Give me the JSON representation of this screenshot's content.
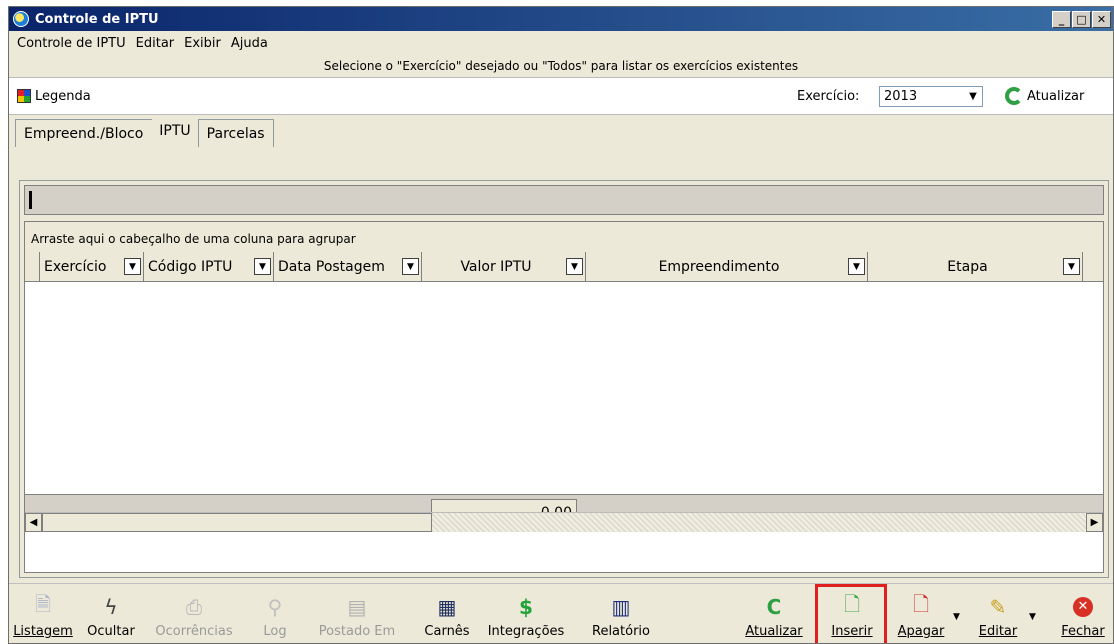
{
  "window": {
    "title": "Controle de IPTU"
  },
  "menu": [
    "Controle de IPTU",
    "Editar",
    "Exibir",
    "Ajuda"
  ],
  "hint": "Selecione o \"Exercício\" desejado ou \"Todos\" para listar os exercícios existentes",
  "filter": {
    "legend_label": "Legenda",
    "exercicio_label": "Exercício:",
    "exercicio_value": "2013",
    "refresh_label": "Atualizar"
  },
  "tabs": [
    {
      "label": "Empreend./Bloco",
      "active": false
    },
    {
      "label": "IPTU",
      "active": true
    },
    {
      "label": "Parcelas",
      "active": false
    }
  ],
  "grid": {
    "group_hint": "Arraste aqui o cabeçalho de uma coluna para agrupar",
    "columns": [
      "Exercício",
      "Código IPTU",
      "Data Postagem",
      "Valor IPTU",
      "Empreendimento",
      "Etapa"
    ],
    "total": "0,00"
  },
  "toolbar": [
    {
      "label": "Listagem",
      "icon": "document-icon",
      "enabled": true
    },
    {
      "label": "Ocultar",
      "icon": "lightning-icon",
      "enabled": true
    },
    {
      "label": "Ocorrências",
      "icon": "printer-icon",
      "enabled": false
    },
    {
      "label": "Log",
      "icon": "magnifier-icon",
      "enabled": false
    },
    {
      "label": "Postado Em",
      "icon": "calendar-icon",
      "enabled": false
    },
    {
      "label": "Carnês",
      "icon": "booklet-icon",
      "enabled": true
    },
    {
      "label": "Integrações",
      "icon": "dollar-icon",
      "enabled": true
    },
    {
      "label": "Relatório",
      "icon": "chart-edit-icon",
      "enabled": true
    },
    {
      "label": "Atualizar",
      "icon": "refresh-icon",
      "enabled": true
    },
    {
      "label": "Inserir",
      "icon": "new-document-icon",
      "enabled": true
    },
    {
      "label": "Apagar",
      "icon": "delete-document-icon",
      "enabled": true
    },
    {
      "label": "Editar",
      "icon": "edit-document-icon",
      "enabled": true
    },
    {
      "label": "Fechar",
      "icon": "close-circle-icon",
      "enabled": true
    }
  ],
  "colors": {
    "highlight": "#e02020",
    "titlebar": "#0a246a",
    "refresh": "#2ea043"
  }
}
